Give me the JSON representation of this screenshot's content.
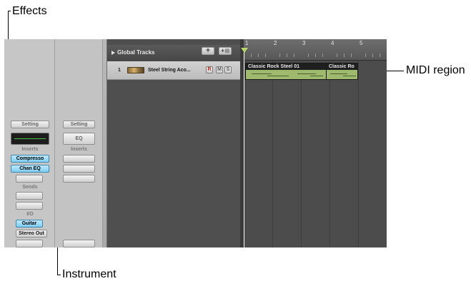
{
  "callouts": {
    "effects": "Effects",
    "midi_region": "MIDI region",
    "instrument": "Instrument"
  },
  "strip1": {
    "setting": "Setting",
    "inserts_label": "Inserts",
    "insert_slots": [
      "Compresso",
      "Chan EQ"
    ],
    "sends_label": "Sends",
    "io_label": "I/O",
    "input": "Guitar",
    "output": "Stereo Out"
  },
  "strip2": {
    "setting": "Setting",
    "eq": "EQ",
    "inserts_label": "Inserts"
  },
  "tracks_header": {
    "label": "Global Tracks",
    "expand_icon": "disclosure-triangle-icon",
    "add_label": "+",
    "folder_label": "+▤"
  },
  "track": {
    "number": "1",
    "name": "Steel String Aco...",
    "record": "R",
    "mute": "M",
    "solo": "S",
    "icon": "acoustic-guitar-icon"
  },
  "ruler": {
    "bars": [
      "1",
      "2",
      "3",
      "4",
      "5"
    ]
  },
  "regions": [
    {
      "name": "Classic Rock Steel 01"
    },
    {
      "name": "Classic Ro"
    }
  ],
  "colors": {
    "insert_active": "#7fcdf2",
    "region_fill": "#9fb96e",
    "playhead_marker": "#b8d66c"
  }
}
